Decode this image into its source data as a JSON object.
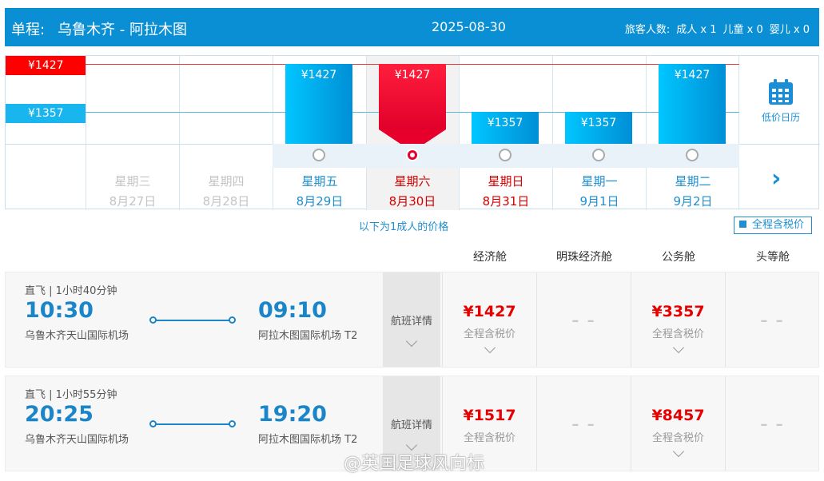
{
  "header": {
    "trip_label": "单程:",
    "route": "乌鲁木齐  -  阿拉木图",
    "date": "2025-08-30",
    "passengers_label": "旅客人数:",
    "adult": "成人 x 1",
    "child": "儿童 x 0",
    "infant": "婴儿 x 0"
  },
  "price_scale": {
    "high": "¥1427",
    "low": "¥1357"
  },
  "calendar": {
    "days": [
      {
        "weekday": "星期三",
        "date": "8月27日",
        "price": "",
        "state": "past"
      },
      {
        "weekday": "星期四",
        "date": "8月28日",
        "price": "",
        "state": "past"
      },
      {
        "weekday": "星期五",
        "date": "8月29日",
        "price": "¥1427",
        "state": "avail"
      },
      {
        "weekday": "星期六",
        "date": "8月30日",
        "price": "¥1427",
        "state": "selected"
      },
      {
        "weekday": "星期日",
        "date": "8月31日",
        "price": "¥1357",
        "state": "weekend"
      },
      {
        "weekday": "星期一",
        "date": "9月1日",
        "price": "¥1357",
        "state": "avail"
      },
      {
        "weekday": "星期二",
        "date": "9月2日",
        "price": "¥1427",
        "state": "avail"
      }
    ],
    "low_price_calendar_label": "低价日历"
  },
  "price_note": "以下为1成人的价格",
  "tax_toggle_label": "全程含税价",
  "class_headers": [
    "经济舱",
    "明珠经济舱",
    "公务舱",
    "头等舱"
  ],
  "flights": [
    {
      "meta": "直飞 | 1小时40分钟",
      "dep_time": "10:30",
      "dep_airport": "乌鲁木齐天山国际机场",
      "arr_time": "09:10",
      "arr_airport": "阿拉木图国际机场 T2",
      "detail_label": "航班详情",
      "prices": [
        {
          "price": "¥1427",
          "tax": "全程含税价"
        },
        {
          "price": "",
          "dash": "– –"
        },
        {
          "price": "¥3357",
          "tax": "全程含税价"
        },
        {
          "price": "",
          "dash": "– –"
        }
      ]
    },
    {
      "meta": "直飞 | 1小时55分钟",
      "dep_time": "20:25",
      "dep_airport": "乌鲁木齐天山国际机场",
      "arr_time": "19:20",
      "arr_airport": "阿拉木图国际机场 T2",
      "detail_label": "航班详情",
      "prices": [
        {
          "price": "¥1517",
          "tax": "全程含税价"
        },
        {
          "price": "",
          "dash": "– –"
        },
        {
          "price": "¥8457",
          "tax": "全程含税价"
        },
        {
          "price": "",
          "dash": "– –"
        }
      ]
    }
  ],
  "watermark": "@英国足球风向标",
  "colors": {
    "header_bg": "#0a8fd4",
    "accent_blue": "#1f8fcf",
    "price_red": "#e60000",
    "selected_red": "#e8002d"
  }
}
